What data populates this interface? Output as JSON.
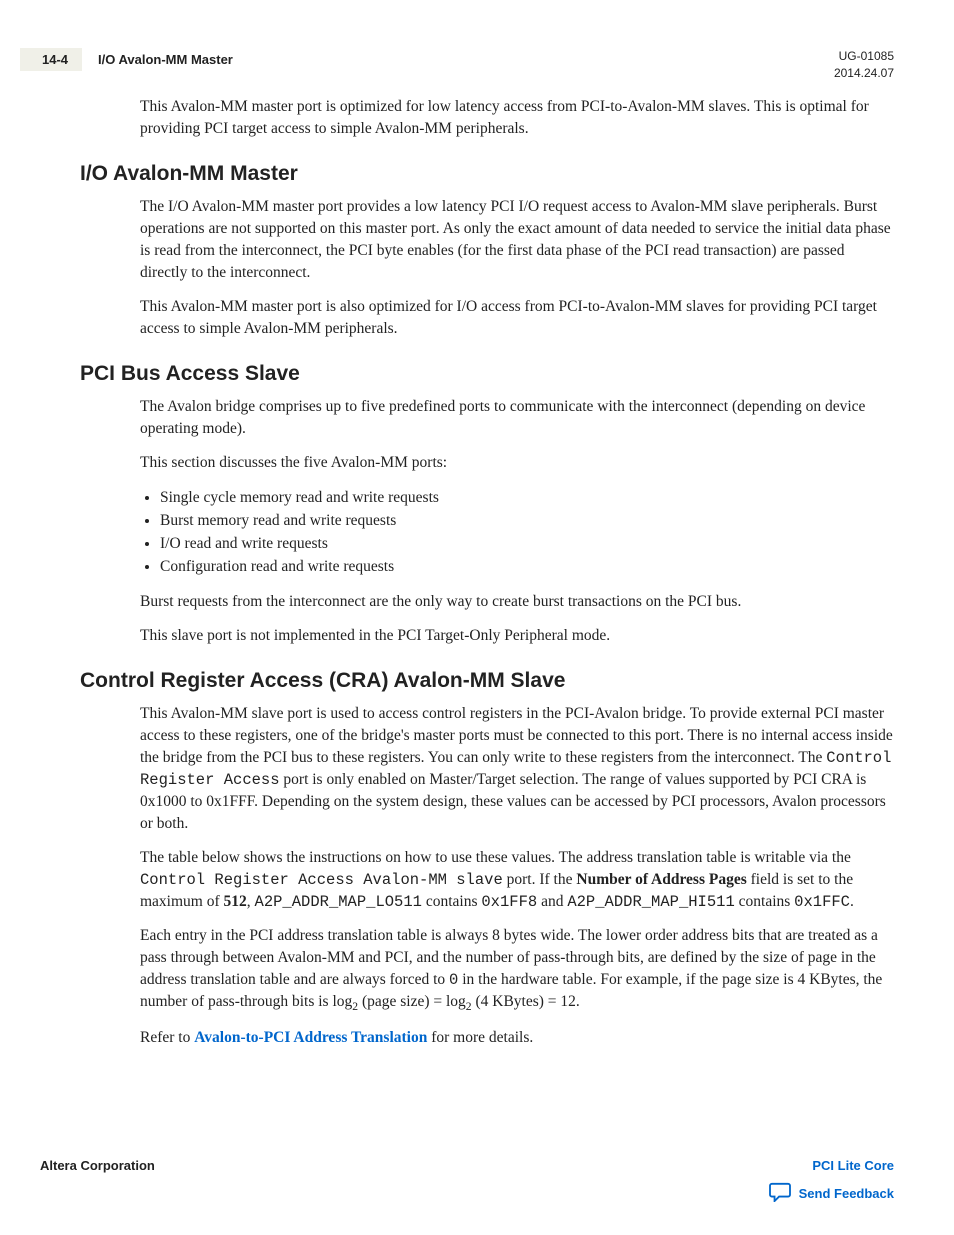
{
  "header": {
    "pageNum": "14-4",
    "title": "I/O Avalon-MM Master",
    "docId": "UG-01085",
    "date": "2014.24.07"
  },
  "intro": "This Avalon-MM master port is optimized for low latency access from PCI-to-Avalon-MM slaves. This is optimal for providing PCI target access to simple Avalon-MM peripherals.",
  "s1": {
    "h": "I/O Avalon-MM Master",
    "p1": "The I/O Avalon-MM master port provides a low latency PCI I/O request access to Avalon-MM slave peripherals. Burst operations are not supported on this master port. As only the exact amount of data needed to service the initial data phase is read from the interconnect, the PCI byte enables (for the first data phase of the PCI read transaction) are passed directly to the interconnect.",
    "p2": "This Avalon-MM master port is also optimized for I/O access from PCI-to-Avalon-MM slaves for providing PCI target access to simple Avalon-MM peripherals."
  },
  "s2": {
    "h": "PCI Bus Access Slave",
    "p1": "The Avalon bridge comprises up to five predefined ports to communicate with the interconnect (depending on device operating mode).",
    "p2": "This section discusses the five Avalon-MM ports:",
    "li1": "Single cycle memory read and write requests",
    "li2": "Burst memory read and write requests",
    "li3": "I/O read and write requests",
    "li4": "Configuration read and write requests",
    "p3": "Burst requests from the interconnect are the only way to create burst transactions on the PCI bus.",
    "p4": "This slave port is not implemented in the PCI Target-Only Peripheral mode."
  },
  "s3": {
    "h": "Control Register Access (CRA) Avalon-MM Slave",
    "p1a": "This Avalon-MM slave port is used to access control registers in the PCI-Avalon bridge. To provide external PCI master access to these registers, one of the bridge's master ports must be connected to this port. There is no internal access inside the bridge from the PCI bus to these registers. You can only write to these registers from the interconnect. The ",
    "p1b": " port is only enabled on Master/Target selection. The range of values supported by PCI CRA is 0x1000 to 0x1FFF. Depending on the system design, these values can be accessed by PCI processors, Avalon processors or both.",
    "p2a": "The table below shows the instructions on how to use these values. The address translation table is writable via the ",
    "p2b": " port. If the ",
    "p2c": "Number of Address Pages",
    "p2d": " field is set to the maximum of ",
    "p2e": "512",
    "p2f": ", ",
    "p2g": " contains ",
    "p2h": " and ",
    "p2i": " contains ",
    "p2j": ".",
    "p3a": "Each entry in the PCI address translation table is always 8 bytes wide. The lower order address bits that are treated as a pass through between Avalon-MM and PCI, and the number of pass-through bits, are defined by the size of page in the address translation table and are always forced to ",
    "p3b": " in the hardware table. For example, if the page size is 4 KBytes, the number of pass-through bits is log",
    "p3c": " (page size) = log",
    "p3d": " (4 KBytes) = 12.",
    "p4a": "Refer to ",
    "p4link": "Avalon-to-PCI Address Translation",
    "p4b": " for more details."
  },
  "footer": {
    "left": "Altera Corporation",
    "right": "PCI Lite Core",
    "feedback": "Send Feedback"
  }
}
